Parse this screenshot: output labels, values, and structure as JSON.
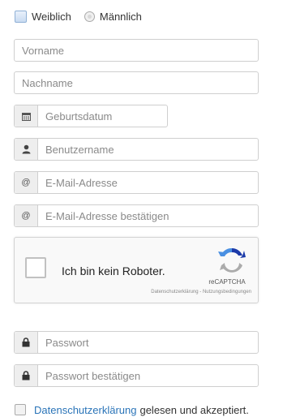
{
  "gender": {
    "female_label": "Weiblich",
    "male_label": "Männlich"
  },
  "fields": {
    "firstname_placeholder": "Vorname",
    "lastname_placeholder": "Nachname",
    "birthdate_placeholder": "Geburtsdatum",
    "username_placeholder": "Benutzername",
    "email_placeholder": "E-Mail-Adresse",
    "email_confirm_placeholder": "E-Mail-Adresse bestätigen",
    "password_placeholder": "Passwort",
    "password_confirm_placeholder": "Passwort bestätigen"
  },
  "icons": {
    "calendar": "calendar-icon",
    "user": "user-icon",
    "at": "@",
    "lock": "lock-icon"
  },
  "captcha": {
    "label": "Ich bin kein Roboter.",
    "brand": "reCAPTCHA",
    "privacy": "Datenschutzerklärung - Nutzungsbedingungen"
  },
  "agreement": {
    "link_text": "Datenschutzerklärung",
    "rest_text": "gelesen und akzeptiert."
  },
  "colors": {
    "link": "#2a74b8",
    "border": "#cfcfcf",
    "addon_bg": "#eeeeee"
  }
}
